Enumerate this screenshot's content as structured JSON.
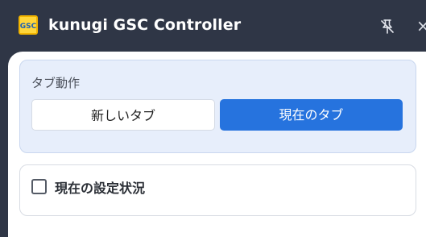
{
  "window": {
    "title": "kunugi GSC Controller",
    "logo_text": "GSC",
    "close_glyph": "×"
  },
  "tab_action": {
    "label": "タブ動作",
    "new_tab_label": "新しいタブ",
    "current_tab_label": "現在のタブ",
    "selected": "current_tab"
  },
  "settings": {
    "checkbox_label": "現在の設定状況",
    "checked": false
  },
  "colors": {
    "titlebar": "#2f3646",
    "accent": "#2673de",
    "card_bg": "#e7eefb"
  },
  "icons": [
    "app-logo-icon",
    "pin-off-icon",
    "close-icon"
  ]
}
